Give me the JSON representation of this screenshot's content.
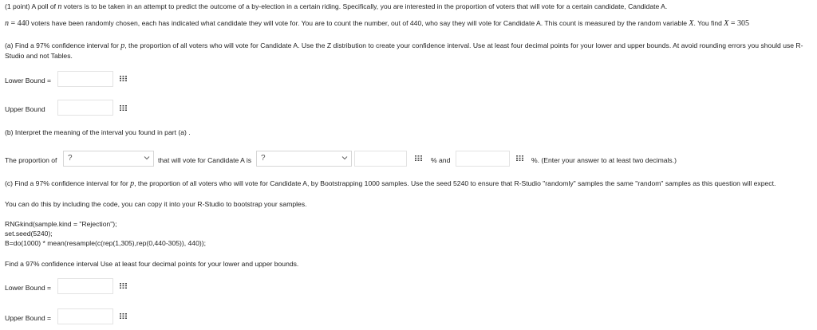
{
  "intro": {
    "prefix": "(1 point) A poll of ",
    "var_n": "n",
    "rest": " voters is to be taken in an attempt to predict the outcome of a by-election in a certain riding. Specifically, you are interested in the proportion of voters that will vote for a certain candidate, Candidate A."
  },
  "line2": {
    "n_var": "n",
    "n_eq": " = 440",
    "text": " voters have been randomly chosen, each has indicated what candidate they will vote for. You are to count the number, out of 440, who say they will vote for Candidate A. This count is measured by the random variable ",
    "X": "X",
    "text2": ". You find ",
    "X2": "X",
    "x_eq": " = 305"
  },
  "part_a": {
    "text1": "(a) Find a 97% confidence interval for ",
    "p": "p",
    "text2": ", the proportion of all voters who will vote for Candidate A. Use the Z distribution to create your confidence interval. Use at least four decimal points for your lower and upper bounds. At avoid rounding errors you should use R-",
    "text3": "Studio and not Tables.",
    "lower_label": "Lower Bound =",
    "upper_label": "Upper Bound",
    "lower_value": "",
    "upper_value": ""
  },
  "part_b": {
    "text": "(b) Interpret the meaning of the interval you found in part (a) .",
    "prefix": "The proportion of",
    "select1": "?",
    "middle": "that will vote for Candidate A is",
    "select2": "?",
    "and_text": "% and",
    "suffix": "%. (Enter your answer to at least two decimals.)",
    "input1_value": "",
    "input2_value": ""
  },
  "part_c": {
    "text1": "(c) Find a 97% confidence interval for for ",
    "p": "p",
    "text2": ", the proportion of all voters who will vote for Candidate A, by Bootstrapping 1000 samples. Use the seed 5240 to ensure that R-Studio \"randomly\" samples the same \"random\" samples as this question will expect.",
    "hint": "You can do this by including the code, you can copy it into your R-Studio to bootstrap your samples.",
    "code1": "RNGkind(sample.kind = \"Rejection\");",
    "code2": "set.seed(5240);",
    "code3": "B=do(1000) * mean(resample(c(rep(1,305),rep(0,440-305)), 440));",
    "instruction": "Find a 97% confidence interval Use at least four decimal points for your lower and upper bounds.",
    "lower_label": "Lower Bound =",
    "upper_label": "Upper Bound =",
    "lower_value": "",
    "upper_value": ""
  },
  "icons": {
    "answer_preview": "grid-icon",
    "dropdown": "chevron-down-icon"
  },
  "colors": {
    "text": "#222222",
    "border": "#e3e3e3"
  }
}
